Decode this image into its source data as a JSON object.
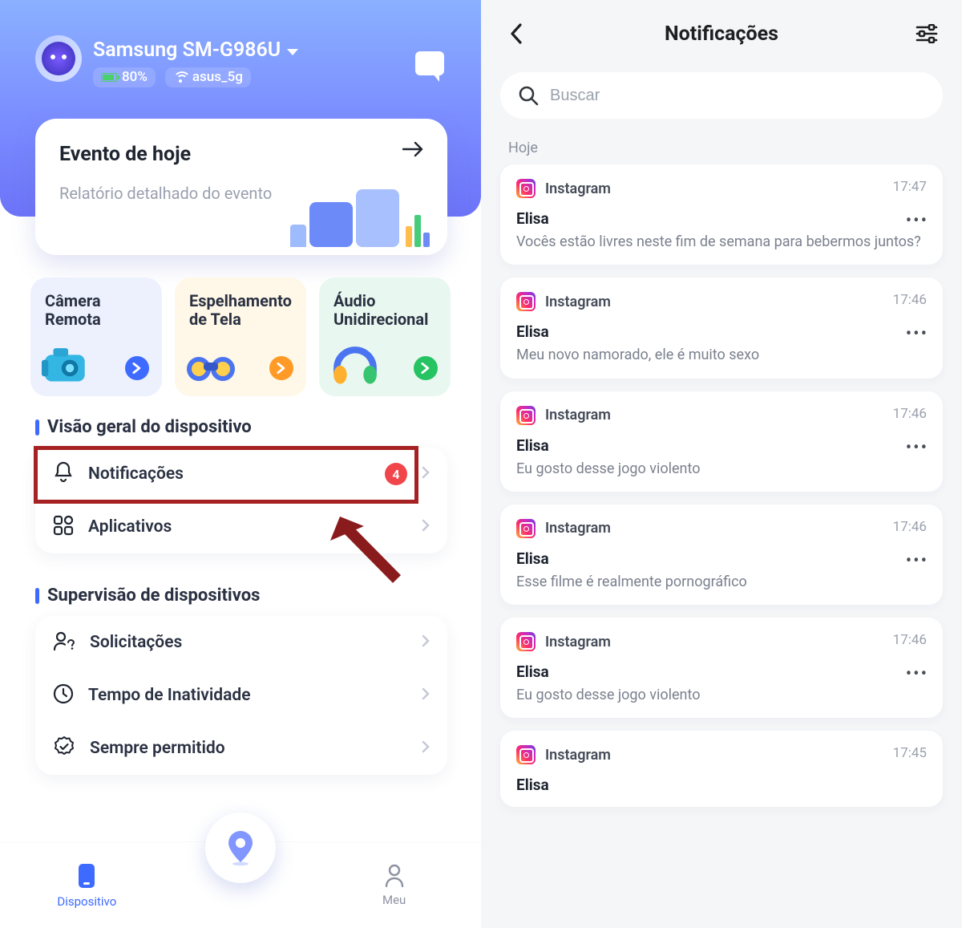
{
  "left": {
    "device": {
      "name": "Samsung SM-G986U",
      "battery_pct": "80%",
      "wifi_ssid": "asus_5g"
    },
    "event_card": {
      "title": "Evento de hoje",
      "subtitle": "Relatório detalhado do evento"
    },
    "tiles": [
      {
        "label": "Câmera Remota"
      },
      {
        "label": "Espelhamento de Tela"
      },
      {
        "label": "Áudio Unidirecional"
      }
    ],
    "section_overview": "Visão geral do dispositivo",
    "overview_rows": {
      "notifications": {
        "label": "Notificações",
        "badge": "4"
      },
      "apps": {
        "label": "Aplicativos"
      }
    },
    "section_supervision": "Supervisão de dispositivos",
    "supervision_rows": {
      "requests": "Solicitações",
      "downtime": "Tempo de Inatividade",
      "allowed": "Sempre permitido"
    },
    "tabs": {
      "device": "Dispositivo",
      "me": "Meu"
    }
  },
  "right": {
    "title": "Notificações",
    "search_placeholder": "Buscar",
    "day_label": "Hoje",
    "items": [
      {
        "app": "Instagram",
        "time": "17:47",
        "from": "Elisa",
        "body": "Vocês estão livres neste fim de semana para bebermos juntos?"
      },
      {
        "app": "Instagram",
        "time": "17:46",
        "from": "Elisa",
        "body": "Meu novo namorado, ele é muito sexo"
      },
      {
        "app": "Instagram",
        "time": "17:46",
        "from": "Elisa",
        "body": "Eu gosto desse jogo violento"
      },
      {
        "app": "Instagram",
        "time": "17:46",
        "from": "Elisa",
        "body": "Esse filme é realmente pornográfico"
      },
      {
        "app": "Instagram",
        "time": "17:46",
        "from": "Elisa",
        "body": "Eu gosto desse jogo violento"
      },
      {
        "app": "Instagram",
        "time": "17:45",
        "from": "Elisa",
        "body": ""
      }
    ]
  }
}
